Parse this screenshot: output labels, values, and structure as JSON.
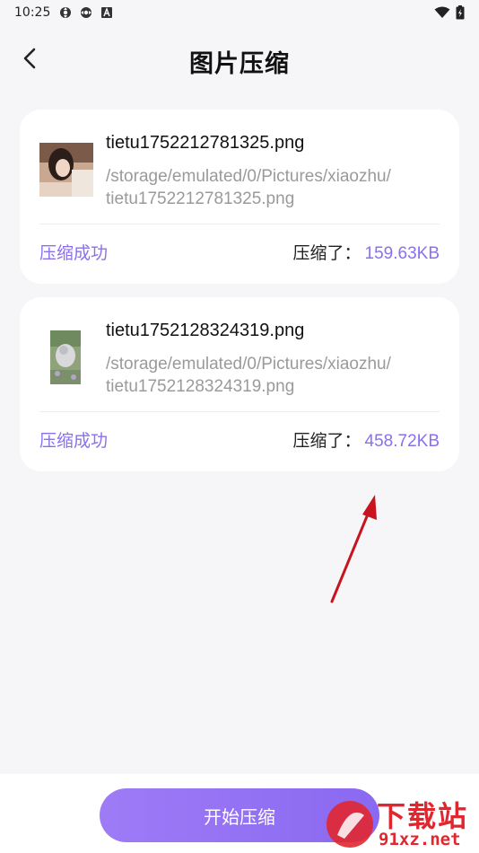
{
  "status_bar": {
    "time": "10:25"
  },
  "header": {
    "title": "图片压缩"
  },
  "files": [
    {
      "name": "tietu1752212781325.png",
      "path_line1": "/storage/emulated/0/Pictures/xiaozhu/",
      "path_line2": "tietu1752212781325.png",
      "status": "压缩成功",
      "saved_label": "压缩了：",
      "saved_value": "159.63KB"
    },
    {
      "name": "tietu1752128324319.png",
      "path_line1": "/storage/emulated/0/Pictures/xiaozhu/",
      "path_line2": "tietu1752128324319.png",
      "status": "压缩成功",
      "saved_label": "压缩了：",
      "saved_value": "458.72KB"
    }
  ],
  "footer": {
    "start_label": "开始压缩"
  },
  "watermark": {
    "big": "下载站",
    "small": "91xz.net"
  },
  "colors": {
    "accent": "#8b6ff0",
    "background": "#f6f6f8",
    "watermark": "#e0272f",
    "arrow": "#c8141e"
  }
}
